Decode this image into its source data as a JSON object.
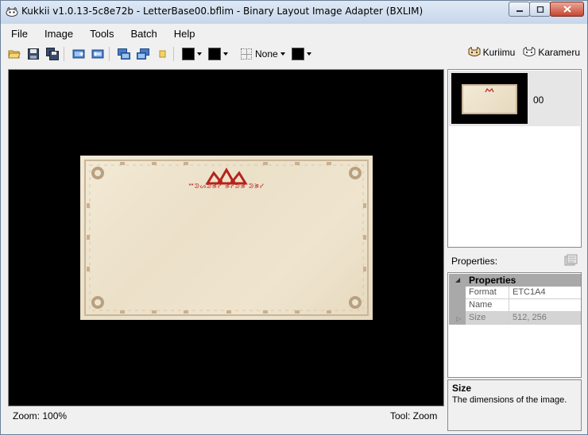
{
  "window": {
    "title": "Kukkii v1.0.13-5c8e72b - LetterBase00.bflim - Binary Layout Image Adapter (BXLIM)",
    "minimize_icon": "minimize-icon",
    "maximize_icon": "maximize-icon",
    "close_icon": "close-icon"
  },
  "menu": {
    "items": [
      "File",
      "Image",
      "Tools",
      "Batch",
      "Help"
    ]
  },
  "toolbar": {
    "icons": [
      "open-folder-icon",
      "save-icon",
      "save-all-icon",
      "export-icon",
      "import-icon",
      "batch-export-icon",
      "batch-import-icon",
      "properties-icon"
    ],
    "background_label": "None",
    "swatch_colors": [
      "#000000",
      "#000000",
      "#000000"
    ],
    "links": [
      "Kuriimu",
      "Karameru"
    ]
  },
  "canvas": {
    "background_color": "#000000",
    "letter_header_text": "ᕯᕲᔕᕲᕒᓯ ᕒᓯᕲᕒ ᕲᕒᓯ"
  },
  "status": {
    "zoom": "Zoom: 100%",
    "tool": "Tool: Zoom"
  },
  "image_list": {
    "items": [
      {
        "label": "00",
        "selected": true
      }
    ]
  },
  "properties": {
    "label": "Properties:",
    "category": "Properties",
    "rows": [
      {
        "name": "Format",
        "value": "ETC1A4",
        "readonly": false
      },
      {
        "name": "Name",
        "value": "",
        "readonly": false
      },
      {
        "name": "Size",
        "value": "512, 256",
        "readonly": true
      }
    ],
    "help_title": "Size",
    "help_desc": "The dimensions of the image."
  }
}
